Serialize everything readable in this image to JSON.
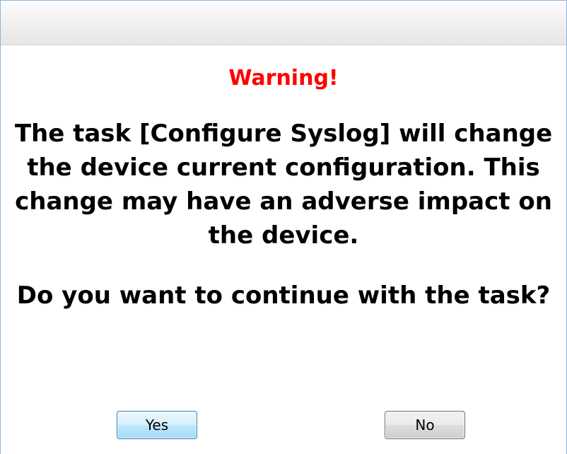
{
  "dialog": {
    "heading": "Warning!",
    "heading_color": "#ff0000",
    "message": "The task [Configure Syslog] will change the device current configuration. This change may have an adverse impact on the device.",
    "question": "Do you want to continue with the task?",
    "buttons": {
      "yes_label": "Yes",
      "no_label": "No"
    }
  }
}
